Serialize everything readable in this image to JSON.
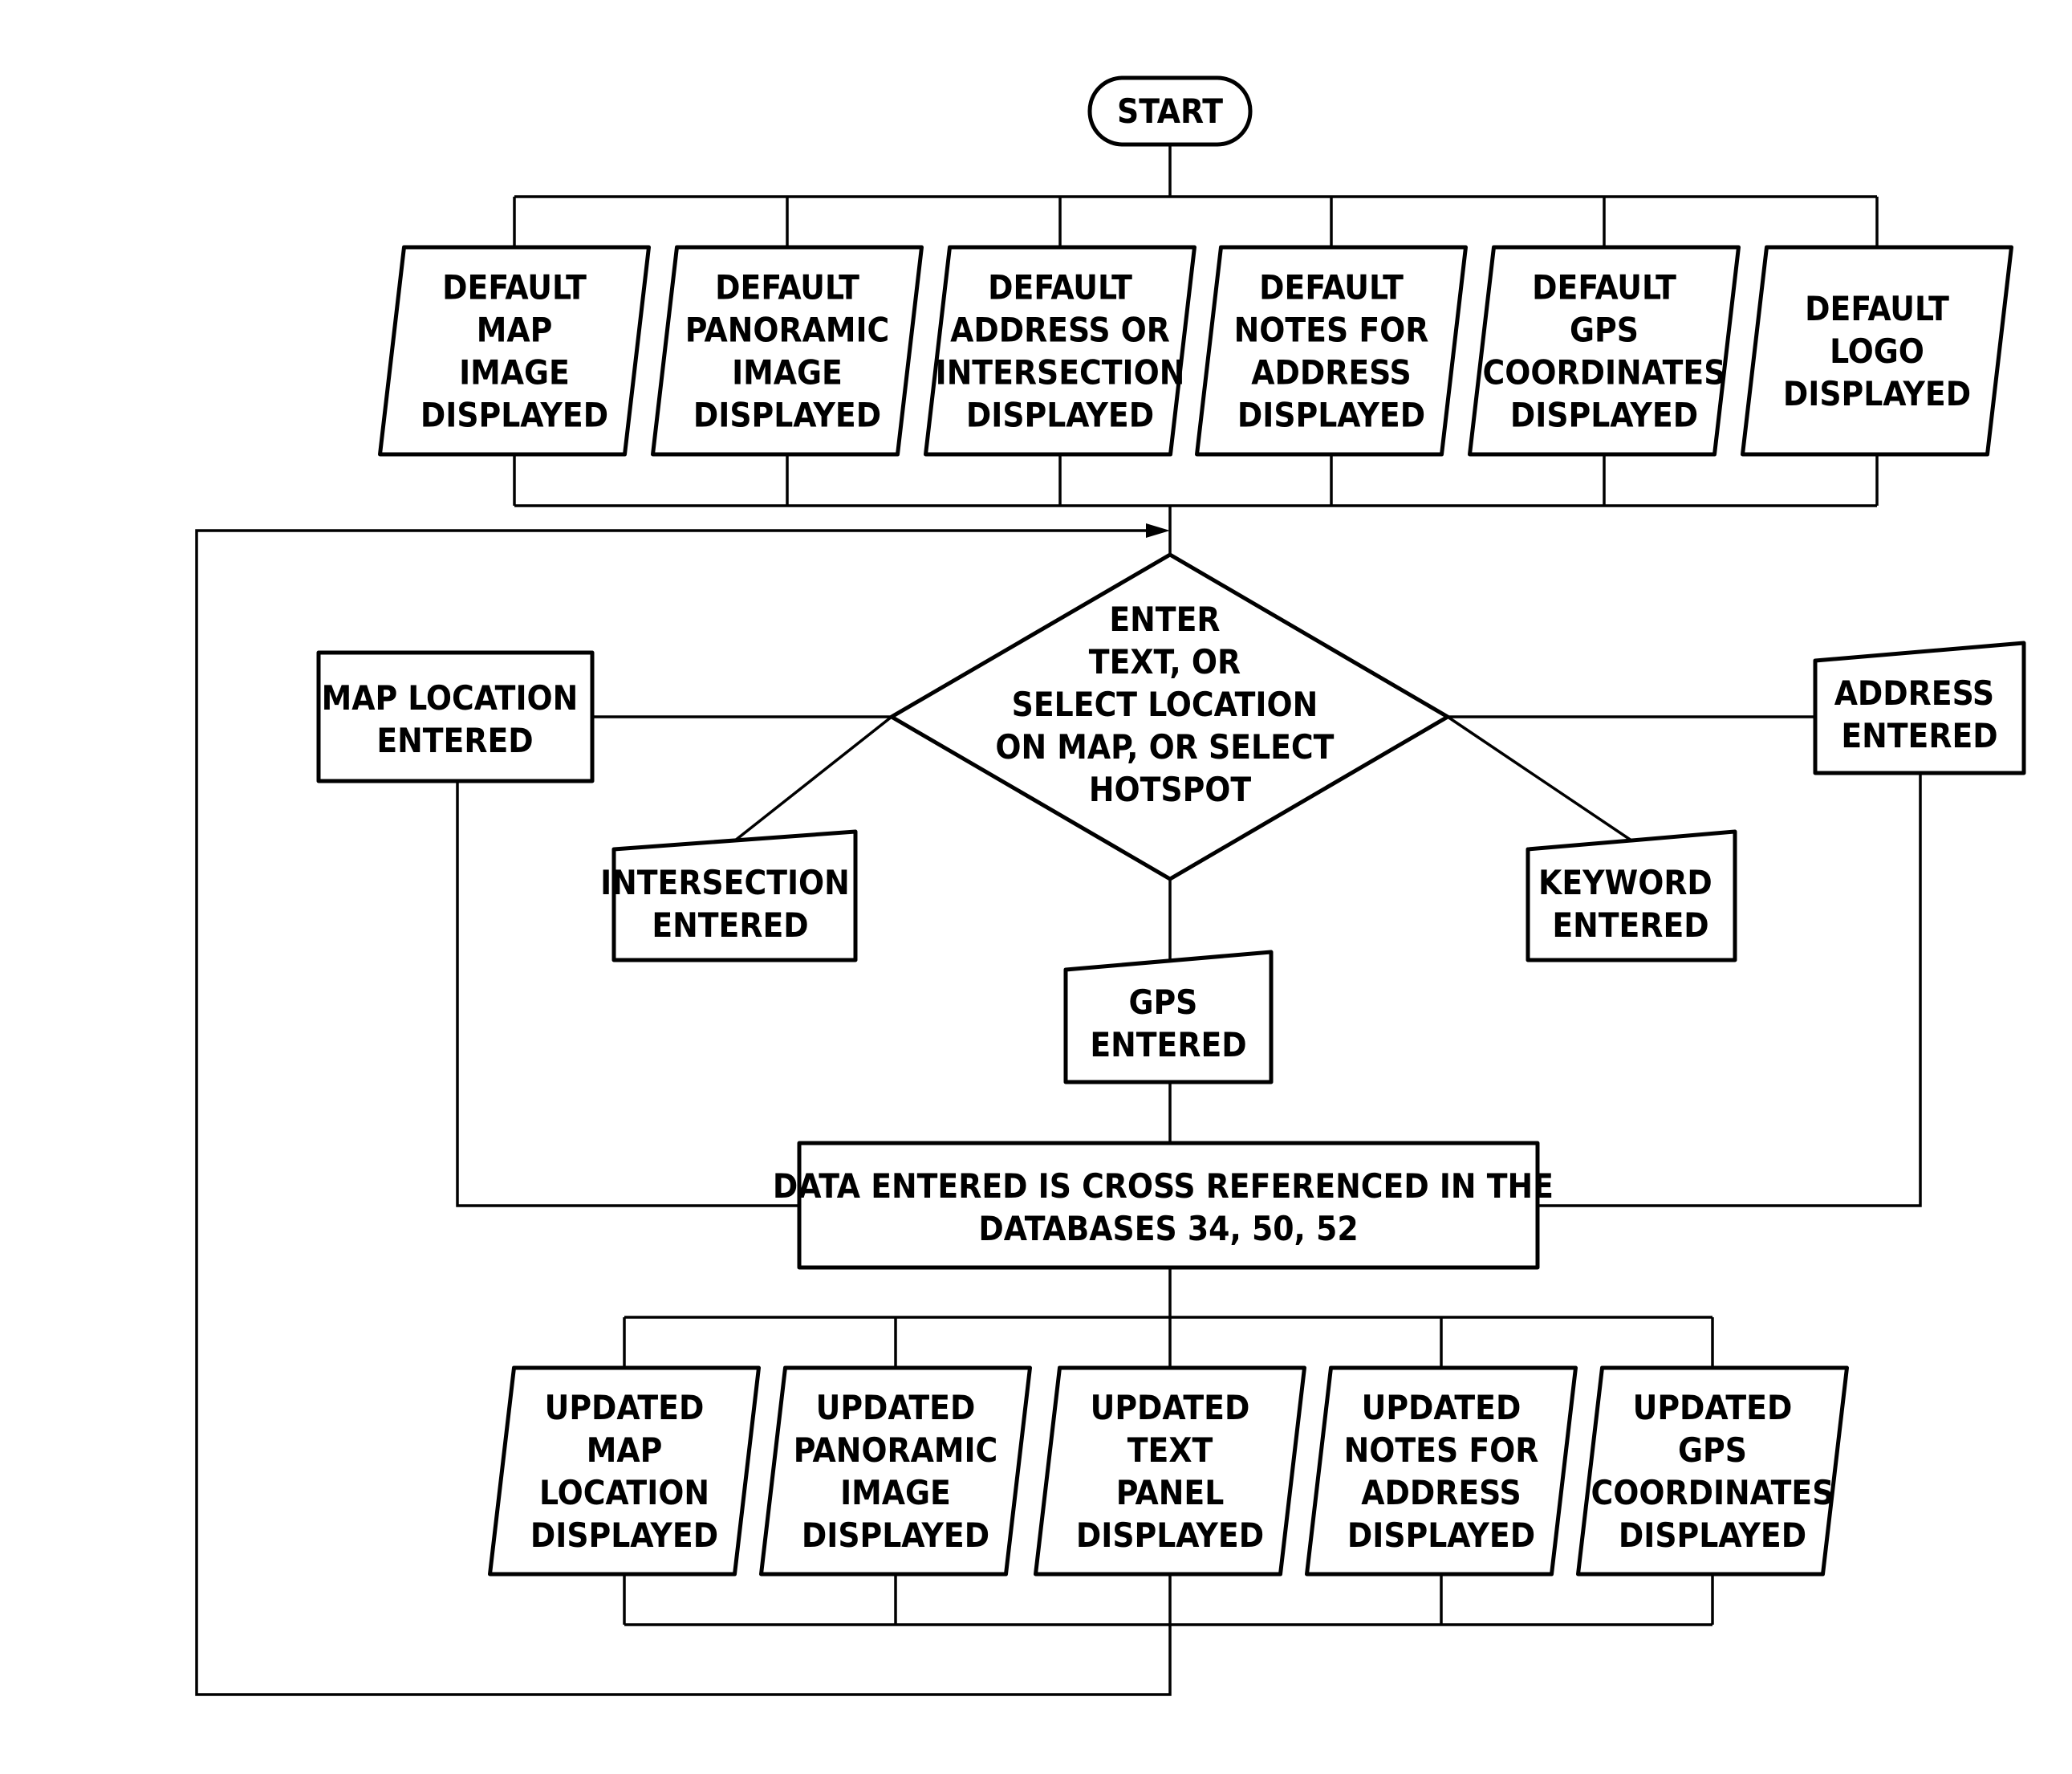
{
  "diagram": {
    "type": "flowchart",
    "start": {
      "label": "START"
    },
    "default_outputs": [
      {
        "lines": [
          "DEFAULT",
          "MAP",
          "IMAGE",
          "DISPLAYED"
        ]
      },
      {
        "lines": [
          "DEFAULT",
          "PANORAMIC",
          "IMAGE",
          "DISPLAYED"
        ]
      },
      {
        "lines": [
          "DEFAULT",
          "ADDRESS OR",
          "INTERSECTION",
          "DISPLAYED"
        ]
      },
      {
        "lines": [
          "DEFAULT",
          "NOTES FOR",
          "ADDRESS",
          "DISPLAYED"
        ]
      },
      {
        "lines": [
          "DEFAULT",
          "GPS",
          "COORDINATES",
          "DISPLAYED"
        ]
      },
      {
        "lines": [
          "DEFAULT",
          "LOGO",
          "DISPLAYED"
        ]
      }
    ],
    "decision": {
      "lines": [
        "ENTER",
        "TEXT, OR",
        "SELECT LOCATION",
        "ON MAP, OR SELECT",
        "HOTSPOT"
      ]
    },
    "inputs": {
      "map_location": {
        "lines": [
          "MAP LOCATION",
          "ENTERED"
        ]
      },
      "intersection": {
        "lines": [
          "INTERSECTION",
          "ENTERED"
        ]
      },
      "gps": {
        "lines": [
          "GPS",
          "ENTERED"
        ]
      },
      "keyword": {
        "lines": [
          "KEYWORD",
          "ENTERED"
        ]
      },
      "address": {
        "lines": [
          "ADDRESS",
          "ENTERED"
        ]
      }
    },
    "process": {
      "lines": [
        "DATA ENTERED IS CROSS REFERENCED IN THE",
        "DATABASES 34, 50, 52"
      ]
    },
    "updated_outputs": [
      {
        "lines": [
          "UPDATED",
          "MAP",
          "LOCATION",
          "DISPLAYED"
        ]
      },
      {
        "lines": [
          "UPDATED",
          "PANORAMIC",
          "IMAGE",
          "DISPLAYED"
        ]
      },
      {
        "lines": [
          "UPDATED",
          "TEXT",
          "PANEL",
          "DISPLAYED"
        ]
      },
      {
        "lines": [
          "UPDATED",
          "NOTES FOR",
          "ADDRESS",
          "DISPLAYED"
        ]
      },
      {
        "lines": [
          "UPDATED",
          "GPS",
          "COORDINATES",
          "DISPLAYED"
        ]
      }
    ]
  }
}
